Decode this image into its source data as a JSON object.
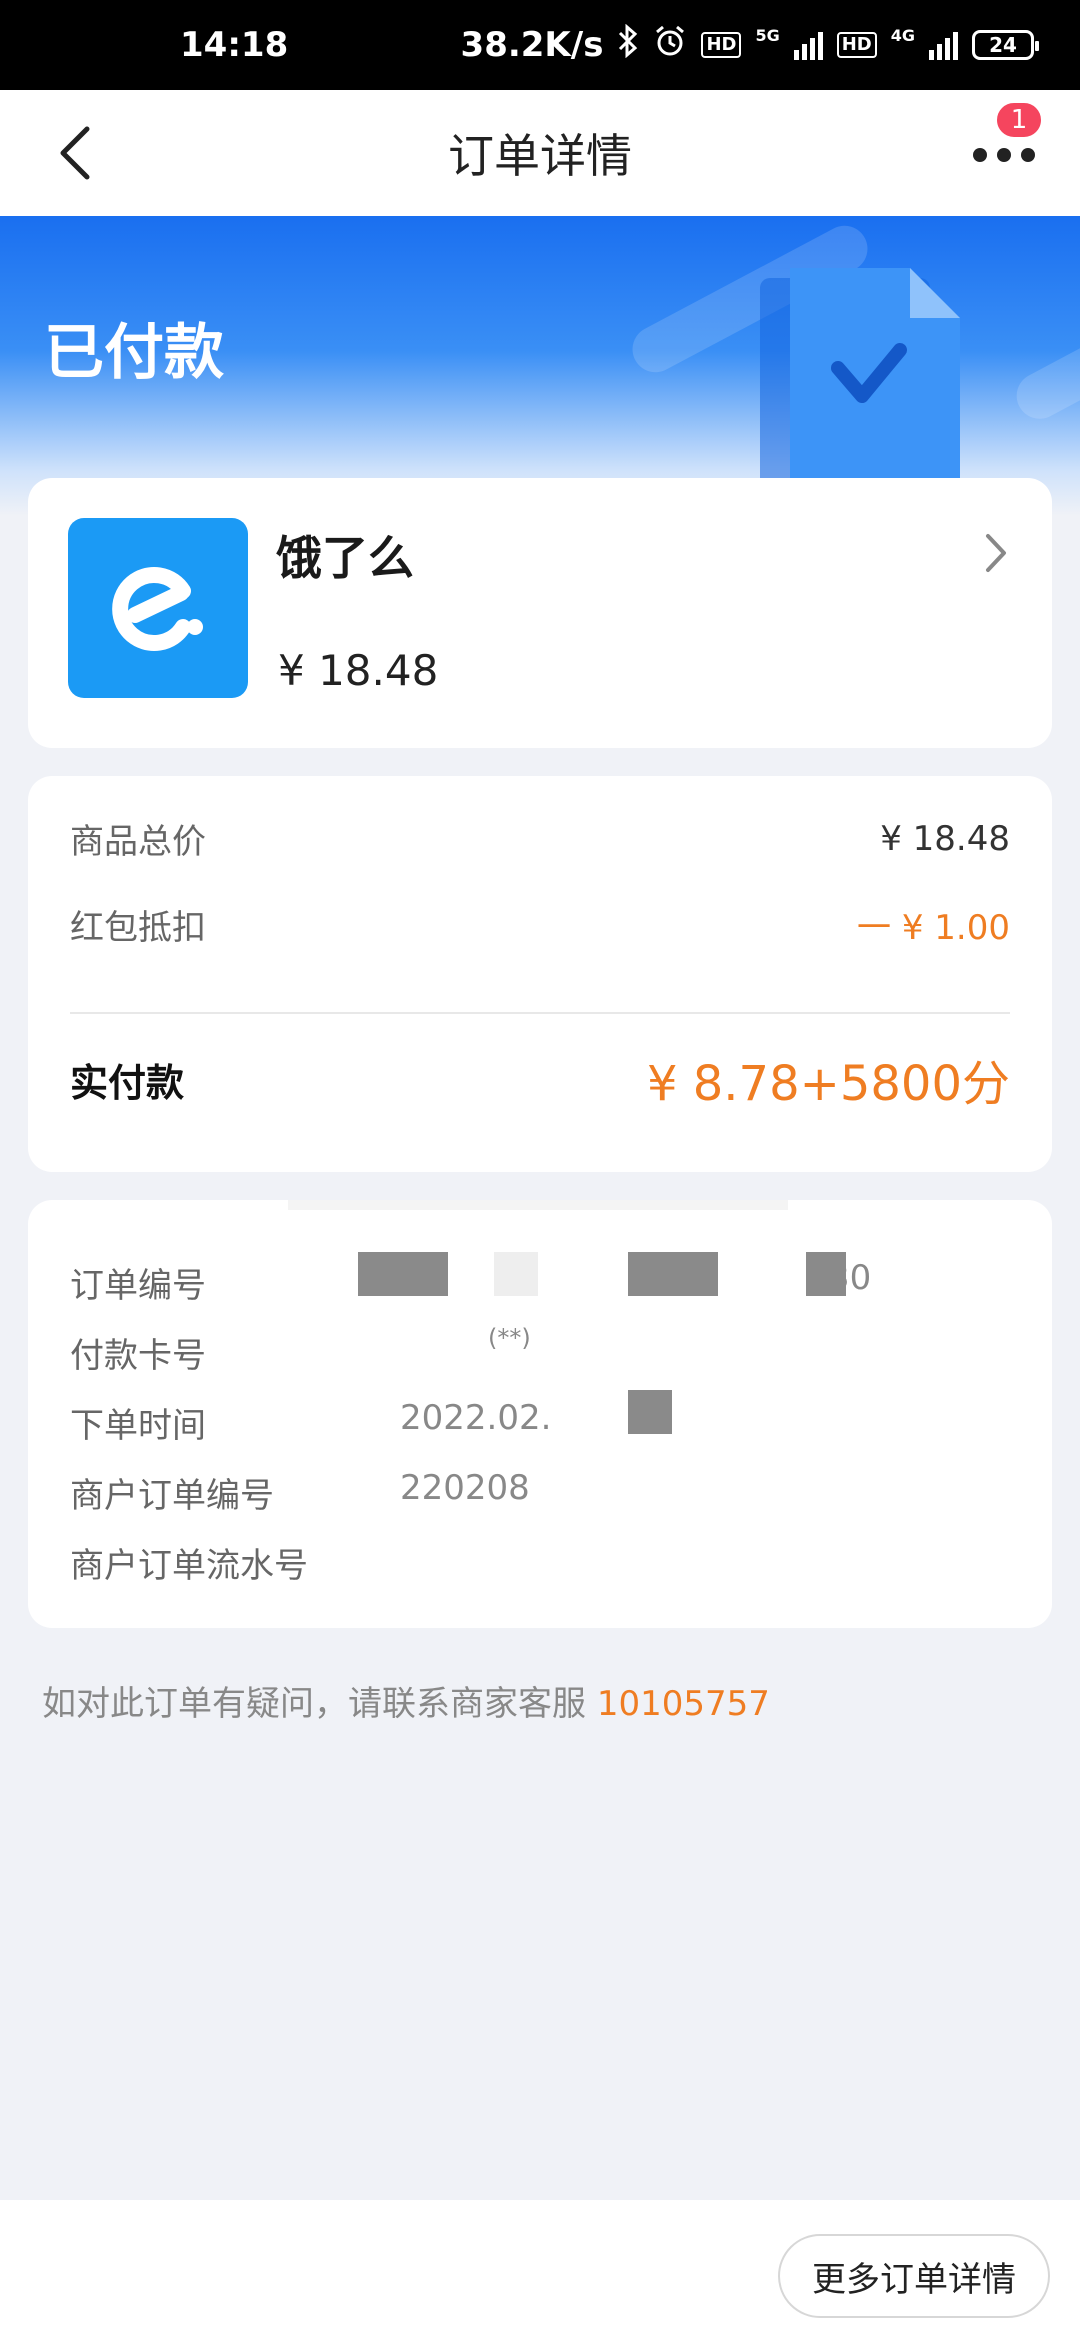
{
  "status_bar": {
    "time": "14:18",
    "network_speed": "38.2K/s",
    "bluetooth_icon": "bluetooth-icon",
    "alarm_icon": "alarm-icon",
    "hd_label": "HD",
    "sim1_network": "5G",
    "sim2_network": "4G",
    "battery_level": "24"
  },
  "nav": {
    "title": "订单详情",
    "back_icon": "chevron-left-icon",
    "more_icon": "more-dots-icon",
    "badge_count": "1"
  },
  "hero": {
    "status_title": "已付款",
    "illustration_icon": "document-check-icon"
  },
  "merchant": {
    "name": "饿了么",
    "amount": "¥ 18.48",
    "logo_icon": "eleme-logo-icon",
    "chevron_icon": "chevron-right-icon"
  },
  "price": {
    "rows": [
      {
        "label": "商品总价",
        "value": "¥ 18.48"
      },
      {
        "label": "红包抵扣",
        "value": "一 ¥ 1.00"
      }
    ],
    "paid_label": "实付款",
    "paid_value": "¥ 8.78+5800分"
  },
  "order_info": {
    "rows": [
      {
        "label": "订单编号",
        "value": "30"
      },
      {
        "label": "付款卡号",
        "value": "(**)"
      },
      {
        "label": "下单时间",
        "value": "2022.02.0"
      },
      {
        "label": "商户订单编号",
        "value": "220208"
      },
      {
        "label": "商户订单流水号",
        "value": ""
      }
    ]
  },
  "help": {
    "text": "如对此订单有疑问，请联系商家客服",
    "phone": "10105757"
  },
  "bottom": {
    "more_details_label": "更多订单详情"
  },
  "colors": {
    "accent_orange": "#ef7d22",
    "hero_blue": "#1a6ff0",
    "badge_red": "#f5455e",
    "logo_blue": "#1b9af5"
  }
}
